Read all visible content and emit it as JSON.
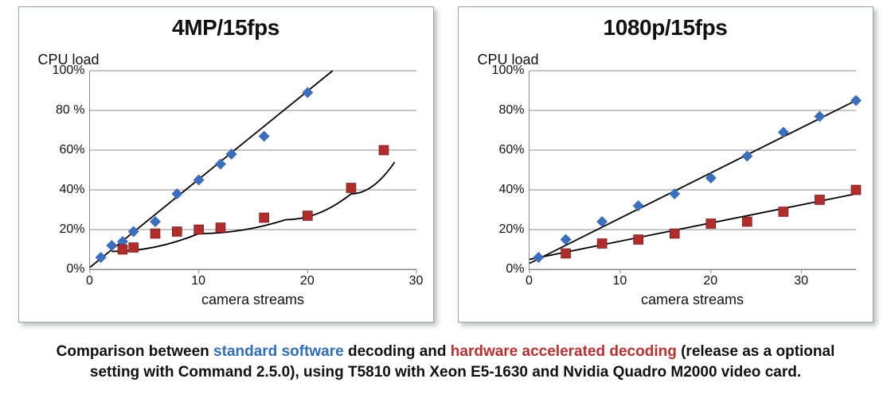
{
  "chart_data": [
    {
      "type": "scatter",
      "title": "4MP/15fps",
      "ylabel": "CPU load",
      "xlabel": "camera streams",
      "ylim": [
        0,
        100
      ],
      "xlim": [
        0,
        30
      ],
      "y_ticks": [
        "0%",
        "20%",
        "40%",
        "60%",
        "80 %",
        "100%"
      ],
      "x_ticks": [
        0,
        10,
        20,
        30
      ],
      "series": [
        {
          "name": "standard software",
          "marker": "diamond",
          "color": "#3a6fbf",
          "x": [
            1,
            2,
            3,
            4,
            6,
            8,
            10,
            12,
            13,
            16,
            20
          ],
          "y": [
            6,
            12,
            14,
            19,
            24,
            38,
            45,
            53,
            58,
            67,
            89
          ],
          "fit": {
            "shape": "line",
            "x": [
              0,
              22.3
            ],
            "y": [
              1,
              100
            ]
          }
        },
        {
          "name": "hardware accelerated",
          "marker": "square",
          "color": "#b22c2c",
          "x": [
            3,
            4,
            6,
            8,
            10,
            12,
            16,
            20,
            24,
            27
          ],
          "y": [
            10,
            11,
            18,
            19,
            20,
            21,
            26,
            27,
            41,
            60
          ],
          "fit": {
            "shape": "curve",
            "x": [
              2,
              10,
              18,
              24,
              28
            ],
            "y": [
              9,
              18,
              25,
              38,
              54
            ]
          }
        }
      ]
    },
    {
      "type": "scatter",
      "title": "1080p/15fps",
      "ylabel": "CPU load",
      "xlabel": "camera streams",
      "ylim": [
        0,
        100
      ],
      "xlim": [
        0,
        36
      ],
      "y_ticks": [
        "0%",
        "20%",
        "40%",
        "60%",
        "80%",
        "100%"
      ],
      "x_ticks": [
        0,
        10,
        20,
        30
      ],
      "series": [
        {
          "name": "standard software",
          "marker": "diamond",
          "color": "#3a6fbf",
          "x": [
            1,
            4,
            8,
            12,
            16,
            20,
            24,
            28,
            32,
            36
          ],
          "y": [
            6,
            15,
            24,
            32,
            38,
            46,
            57,
            69,
            77,
            85
          ],
          "fit": {
            "shape": "line",
            "x": [
              0,
              36
            ],
            "y": [
              3,
              85
            ]
          }
        },
        {
          "name": "hardware accelerated",
          "marker": "square",
          "color": "#b22c2c",
          "x": [
            4,
            8,
            12,
            16,
            20,
            24,
            28,
            32,
            36
          ],
          "y": [
            8,
            13,
            15,
            18,
            23,
            24,
            29,
            35,
            40
          ],
          "fit": {
            "shape": "line",
            "x": [
              0,
              36
            ],
            "y": [
              5,
              38
            ]
          }
        }
      ]
    }
  ],
  "caption": {
    "p1a": "Comparison between ",
    "blue": "standard software",
    "p1b": " decoding and ",
    "red": "hardware accelerated decoding",
    "p1c": " (release as a optional",
    "p2": "setting with Command 2.5.0), using T5810 with Xeon E5-1630 and Nvidia Quadro M2000 video card."
  }
}
